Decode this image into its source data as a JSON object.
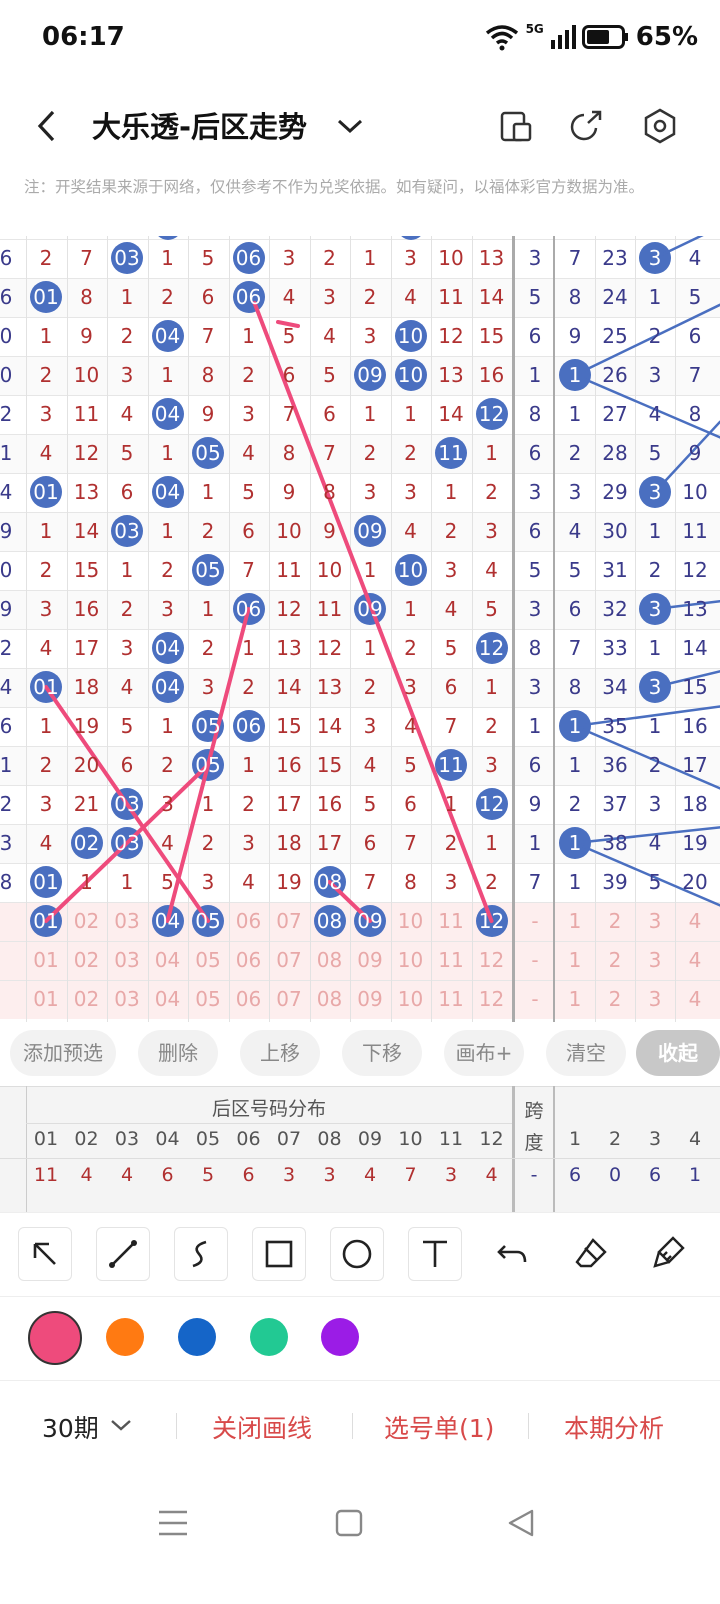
{
  "status_bar": {
    "time": "06:17",
    "network": "5G",
    "battery": "65%"
  },
  "header": {
    "title": "大乐透-后区走势"
  },
  "note": "注：开奖结果来源于网络，仅供参考不作为兑奖依据。如有疑问，以福体彩官方数据为准。",
  "table": {
    "rows": [
      {
        "lead": "6",
        "nums": [
          "2",
          "7",
          "03",
          "1",
          "5",
          "06",
          "3",
          "2",
          "1",
          "3",
          "10",
          "13"
        ],
        "balls": [
          2,
          5
        ],
        "span": "3",
        "b": [
          "7",
          "23",
          "3",
          "4"
        ],
        "bball": 2
      },
      {
        "lead": "6",
        "nums": [
          "01",
          "8",
          "1",
          "2",
          "6",
          "06",
          "4",
          "3",
          "2",
          "4",
          "11",
          "14"
        ],
        "balls": [
          0,
          5
        ],
        "span": "5",
        "b": [
          "8",
          "24",
          "1",
          "5"
        ],
        "bball": -1
      },
      {
        "lead": "0",
        "nums": [
          "1",
          "9",
          "2",
          "04",
          "7",
          "1",
          "5",
          "4",
          "3",
          "10",
          "12",
          "15"
        ],
        "balls": [
          3,
          9
        ],
        "span": "6",
        "b": [
          "9",
          "25",
          "2",
          "6"
        ],
        "bball": -1
      },
      {
        "lead": "0",
        "nums": [
          "2",
          "10",
          "3",
          "1",
          "8",
          "2",
          "6",
          "5",
          "09",
          "10",
          "13",
          "16"
        ],
        "balls": [
          8,
          9
        ],
        "span": "1",
        "b": [
          "1",
          "26",
          "3",
          "7"
        ],
        "bball": 0
      },
      {
        "lead": "2",
        "nums": [
          "3",
          "11",
          "4",
          "04",
          "9",
          "3",
          "7",
          "6",
          "1",
          "1",
          "14",
          "12"
        ],
        "balls": [
          3,
          11
        ],
        "span": "8",
        "b": [
          "1",
          "27",
          "4",
          "8"
        ],
        "bball": -1
      },
      {
        "lead": "1",
        "nums": [
          "4",
          "12",
          "5",
          "1",
          "05",
          "4",
          "8",
          "7",
          "2",
          "2",
          "11",
          "1"
        ],
        "balls": [
          4,
          10
        ],
        "span": "6",
        "b": [
          "2",
          "28",
          "5",
          "9"
        ],
        "bball": -1
      },
      {
        "lead": "4",
        "nums": [
          "01",
          "13",
          "6",
          "04",
          "1",
          "5",
          "9",
          "8",
          "3",
          "3",
          "1",
          "2"
        ],
        "balls": [
          0,
          3
        ],
        "span": "3",
        "b": [
          "3",
          "29",
          "3",
          "10"
        ],
        "bball": 2
      },
      {
        "lead": "9",
        "nums": [
          "1",
          "14",
          "03",
          "1",
          "2",
          "6",
          "10",
          "9",
          "09",
          "4",
          "2",
          "3"
        ],
        "balls": [
          2,
          8
        ],
        "span": "6",
        "b": [
          "4",
          "30",
          "1",
          "11"
        ],
        "bball": -1
      },
      {
        "lead": "0",
        "nums": [
          "2",
          "15",
          "1",
          "2",
          "05",
          "7",
          "11",
          "10",
          "1",
          "10",
          "3",
          "4"
        ],
        "balls": [
          4,
          9
        ],
        "span": "5",
        "b": [
          "5",
          "31",
          "2",
          "12"
        ],
        "bball": -1
      },
      {
        "lead": "9",
        "nums": [
          "3",
          "16",
          "2",
          "3",
          "1",
          "06",
          "12",
          "11",
          "09",
          "1",
          "4",
          "5"
        ],
        "balls": [
          5,
          8
        ],
        "span": "3",
        "b": [
          "6",
          "32",
          "3",
          "13"
        ],
        "bball": 2
      },
      {
        "lead": "2",
        "nums": [
          "4",
          "17",
          "3",
          "04",
          "2",
          "1",
          "13",
          "12",
          "1",
          "2",
          "5",
          "12"
        ],
        "balls": [
          3,
          11
        ],
        "span": "8",
        "b": [
          "7",
          "33",
          "1",
          "14"
        ],
        "bball": -1
      },
      {
        "lead": "4",
        "nums": [
          "01",
          "18",
          "4",
          "04",
          "3",
          "2",
          "14",
          "13",
          "2",
          "3",
          "6",
          "1"
        ],
        "balls": [
          0,
          3
        ],
        "span": "3",
        "b": [
          "8",
          "34",
          "3",
          "15"
        ],
        "bball": 2
      },
      {
        "lead": "6",
        "nums": [
          "1",
          "19",
          "5",
          "1",
          "05",
          "06",
          "15",
          "14",
          "3",
          "4",
          "7",
          "2"
        ],
        "balls": [
          4,
          5
        ],
        "span": "1",
        "b": [
          "1",
          "35",
          "1",
          "16"
        ],
        "bball": 0
      },
      {
        "lead": "1",
        "nums": [
          "2",
          "20",
          "6",
          "2",
          "05",
          "1",
          "16",
          "15",
          "4",
          "5",
          "11",
          "3"
        ],
        "balls": [
          4,
          10
        ],
        "span": "6",
        "b": [
          "1",
          "36",
          "2",
          "17"
        ],
        "bball": -1
      },
      {
        "lead": "2",
        "nums": [
          "3",
          "21",
          "03",
          "3",
          "1",
          "2",
          "17",
          "16",
          "5",
          "6",
          "1",
          "12"
        ],
        "balls": [
          2,
          11
        ],
        "span": "9",
        "b": [
          "2",
          "37",
          "3",
          "18"
        ],
        "bball": -1
      },
      {
        "lead": "3",
        "nums": [
          "4",
          "02",
          "03",
          "4",
          "2",
          "3",
          "18",
          "17",
          "6",
          "7",
          "2",
          "1"
        ],
        "balls": [
          1,
          2
        ],
        "span": "1",
        "b": [
          "1",
          "38",
          "4",
          "19"
        ],
        "bball": 0
      },
      {
        "lead": "8",
        "nums": [
          "01",
          "1",
          "1",
          "5",
          "3",
          "4",
          "19",
          "08",
          "7",
          "8",
          "3",
          "2"
        ],
        "balls": [
          0,
          7
        ],
        "span": "7",
        "b": [
          "1",
          "39",
          "5",
          "20"
        ],
        "bball": -1
      }
    ],
    "pick_row": {
      "nums": [
        "01",
        "02",
        "03",
        "04",
        "05",
        "06",
        "07",
        "08",
        "09",
        "10",
        "11",
        "12"
      ],
      "balls": [
        0,
        3,
        4,
        7,
        8,
        11
      ],
      "span": "-",
      "b": [
        "1",
        "2",
        "3",
        "4"
      ]
    },
    "pred_rows": [
      {
        "nums": [
          "01",
          "02",
          "03",
          "04",
          "05",
          "06",
          "07",
          "08",
          "09",
          "10",
          "11",
          "12"
        ],
        "span": "-",
        "b": [
          "1",
          "2",
          "3",
          "4"
        ]
      },
      {
        "nums": [
          "01",
          "02",
          "03",
          "04",
          "05",
          "06",
          "07",
          "08",
          "09",
          "10",
          "11",
          "12"
        ],
        "span": "-",
        "b": [
          "1",
          "2",
          "3",
          "4"
        ]
      }
    ]
  },
  "actions": [
    "添加预选",
    "删除",
    "上移",
    "下移",
    "画布+",
    "清空",
    "收起"
  ],
  "lower_table": {
    "group_title": "后区号码分布",
    "span_title_1": "跨",
    "span_title_2": "度",
    "columns": [
      "01",
      "02",
      "03",
      "04",
      "05",
      "06",
      "07",
      "08",
      "09",
      "10",
      "11",
      "12"
    ],
    "right_columns": [
      "1",
      "2",
      "3",
      "4"
    ],
    "stats_row": [
      "11",
      "4",
      "4",
      "6",
      "5",
      "6",
      "3",
      "3",
      "4",
      "7",
      "3",
      "4"
    ],
    "stats_span": "-",
    "stats_right": [
      "6",
      "0",
      "6",
      "1"
    ]
  },
  "draw_tools": [
    "arrow-tool",
    "line-tool",
    "curve-tool",
    "rectangle-tool",
    "circle-tool",
    "text-tool",
    "undo-tool",
    "eraser-tool",
    "clear-brush-tool"
  ],
  "draw_colors": [
    "#ee4b7c",
    "#ff7a12",
    "#1565c8",
    "#22c993",
    "#9b1ce6"
  ],
  "bottom_bar": {
    "period": "30期",
    "close_lines": "关闭画线",
    "pick_list": "选号单(1)",
    "analysis": "本期分析"
  }
}
